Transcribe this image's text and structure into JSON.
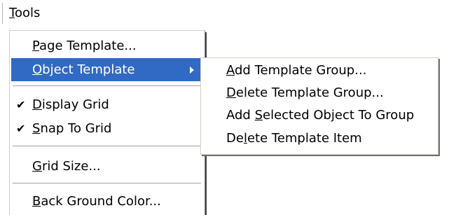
{
  "menubar": {
    "tools": {
      "before": "",
      "accel": "T",
      "after": "ools"
    }
  },
  "menu": {
    "page_template": {
      "before": "",
      "accel": "P",
      "after": "age Template..."
    },
    "object_template": {
      "before": "",
      "accel": "O",
      "after": "bject Template"
    },
    "display_grid": {
      "check": "✔",
      "before": "",
      "accel": "D",
      "after": "isplay Grid"
    },
    "snap_to_grid": {
      "check": "✔",
      "before": "",
      "accel": "S",
      "after": "nap To Grid"
    },
    "grid_size": {
      "before": "",
      "accel": "G",
      "after": "rid Size..."
    },
    "back_ground_color": {
      "before": "",
      "accel": "B",
      "after": "ack Ground Color..."
    }
  },
  "submenu": {
    "add_template_group": {
      "before": "",
      "accel": "A",
      "after": "dd Template Group..."
    },
    "delete_template_group": {
      "before": "",
      "accel": "D",
      "after": "elete Template Group..."
    },
    "add_selected_object": {
      "before": "Add ",
      "accel": "S",
      "after": "elected Object To Group"
    },
    "delete_template_item": {
      "before": "De",
      "accel": "l",
      "after": "ete Template Item"
    }
  },
  "colors": {
    "highlight": "#316ac5",
    "highlight_text": "#ffffff"
  },
  "icons": {
    "submenu_arrow": "right-triangle-icon",
    "check": "checkmark-icon"
  }
}
